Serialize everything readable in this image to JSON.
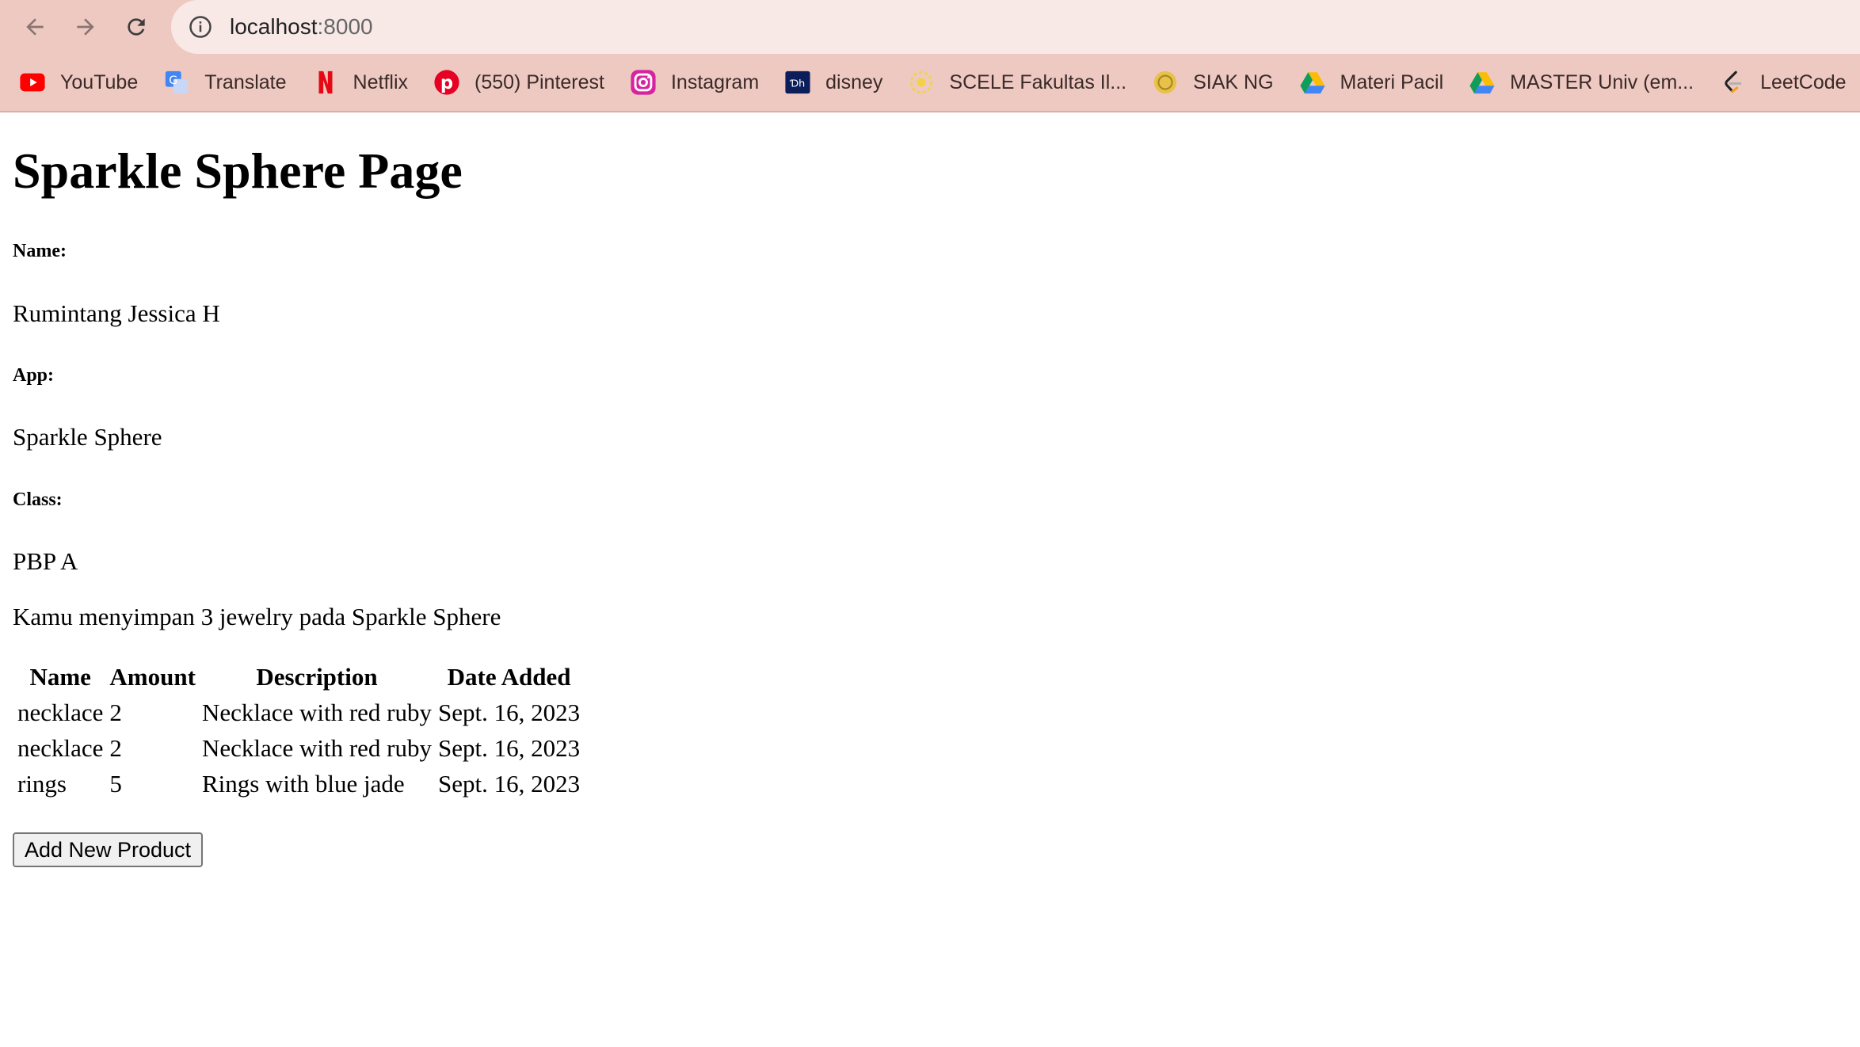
{
  "browser": {
    "url_host": "localhost",
    "url_port": ":8000",
    "bookmarks": [
      {
        "label": "YouTube",
        "icon": "youtube-icon"
      },
      {
        "label": "Translate",
        "icon": "translate-icon"
      },
      {
        "label": "Netflix",
        "icon": "netflix-icon"
      },
      {
        "label": "(550) Pinterest",
        "icon": "pinterest-icon"
      },
      {
        "label": "Instagram",
        "icon": "instagram-icon"
      },
      {
        "label": "disney",
        "icon": "disney-icon"
      },
      {
        "label": "SCELE Fakultas Il...",
        "icon": "scele-icon"
      },
      {
        "label": "SIAK NG",
        "icon": "siak-icon"
      },
      {
        "label": "Materi Pacil",
        "icon": "google-drive-icon"
      },
      {
        "label": "MASTER Univ (em...",
        "icon": "google-drive-icon"
      },
      {
        "label": "LeetCode",
        "icon": "leetcode-icon"
      }
    ]
  },
  "page": {
    "title": "Sparkle Sphere Page",
    "name_label": "Name:",
    "name_value": "Rumintang Jessica H",
    "app_label": "App:",
    "app_value": "Sparkle Sphere",
    "class_label": "Class:",
    "class_value": "PBP A",
    "summary": "Kamu menyimpan 3 jewelry pada Sparkle Sphere",
    "table": {
      "headers": [
        "Name",
        "Amount",
        "Description",
        "Date Added"
      ],
      "rows": [
        [
          "necklace",
          "2",
          "Necklace with red ruby",
          "Sept. 16, 2023"
        ],
        [
          "necklace",
          "2",
          "Necklace with red ruby",
          "Sept. 16, 2023"
        ],
        [
          "rings",
          "5",
          "Rings with blue jade",
          "Sept. 16, 2023"
        ]
      ]
    },
    "add_button_label": "Add New Product"
  }
}
